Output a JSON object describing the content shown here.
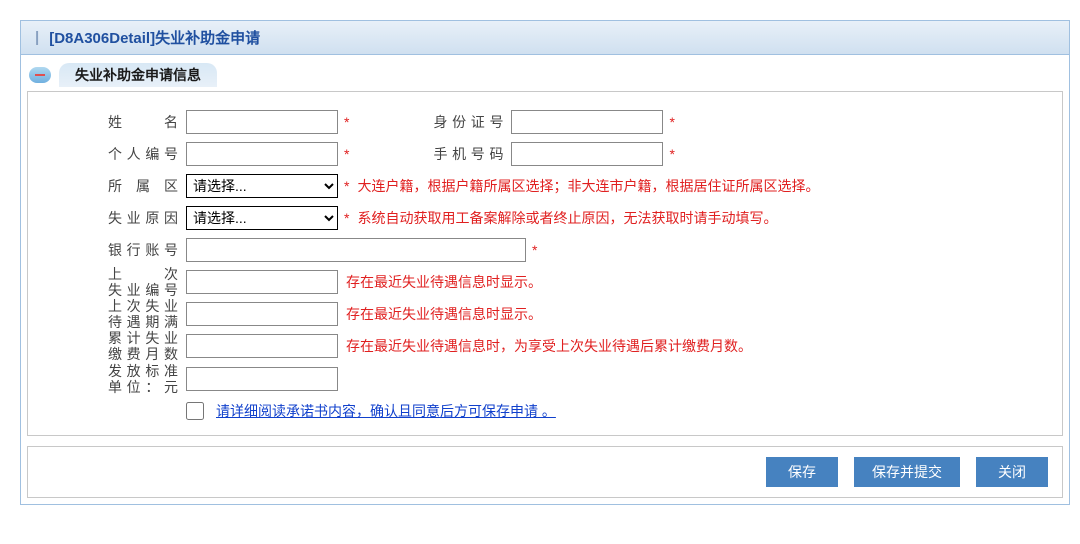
{
  "header": {
    "title": "[D8A306Detail]失业补助金申请"
  },
  "section": {
    "title": "失业补助金申请信息"
  },
  "fields": {
    "name_label": "姓　　名",
    "name_value": "",
    "idcard_label": "身份证号",
    "idcard_value": "",
    "personal_no_label": "个人编号",
    "personal_no_value": "",
    "phone_label": "手机号码",
    "phone_value": "",
    "district_label": "所 属 区",
    "district_options": [
      "请选择..."
    ],
    "district_hint": "大连户籍，根据户籍所属区选择；非大连市户籍，根据居住证所属区选择。",
    "reason_label": "失业原因",
    "reason_options": [
      "请选择..."
    ],
    "reason_hint": "系统自动获取用工备案解除或者终止原因，无法获取时请手动填写。",
    "bank_label": "银行账号",
    "bank_value": "",
    "last_job_no_label": "上　　次\n失业编号",
    "last_job_no_hint": "存在最近失业待遇信息时显示。",
    "last_expire_label": "上次失业\n待遇期满",
    "last_expire_hint": "存在最近失业待遇信息时显示。",
    "total_months_label": "累计失业\n缴费月数",
    "total_months_hint": "存在最近失业待遇信息时，为享受上次失业待遇后累计缴费月数。",
    "pay_std_label": "发放标准\n单位：元"
  },
  "agreement": {
    "link_text": "请详细阅读承诺书内容，确认且同意后方可保存申请 。"
  },
  "buttons": {
    "save": "保存",
    "save_submit": "保存并提交",
    "close": "关闭"
  },
  "star": "*"
}
